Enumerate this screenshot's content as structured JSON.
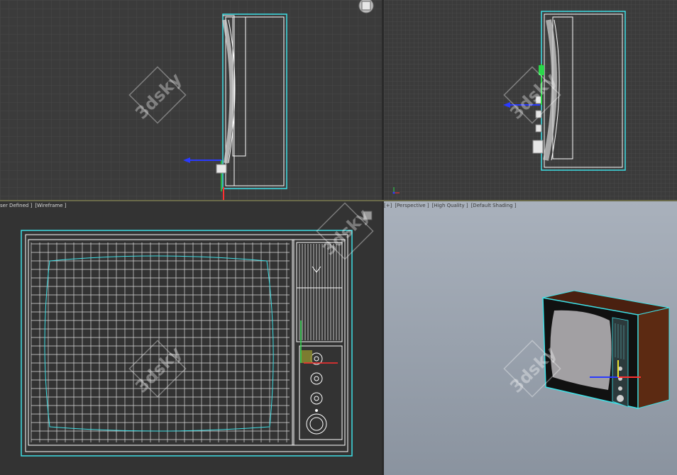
{
  "viewports": [
    {
      "id": "top-left",
      "label_parts": []
    },
    {
      "id": "top-right",
      "label_parts": []
    },
    {
      "id": "bottom-left",
      "label_parts": [
        "[",
        "ser Defined ]",
        "[Wireframe ]"
      ]
    },
    {
      "id": "bottom-right",
      "label_parts": [
        "[+]",
        "[Perspective ]",
        "[High Quality ]",
        "[Default Shading ]"
      ]
    }
  ],
  "watermark": "3dsky",
  "colors": {
    "viewport_bg": "#3b3b3b",
    "grid": "#4a4a4a",
    "wire": "#ffffff",
    "selection": "#3ee0e6",
    "perspective_bg_top": "#a8b0bb",
    "perspective_bg_bottom": "#8b94a0",
    "wood": "#5a2a14",
    "divider": "#6a6a4a"
  },
  "icons": [
    "viewcube-icon",
    "axis-gizmo-icon",
    "transform-gizmo-icon",
    "maximize-viewport-icon"
  ]
}
